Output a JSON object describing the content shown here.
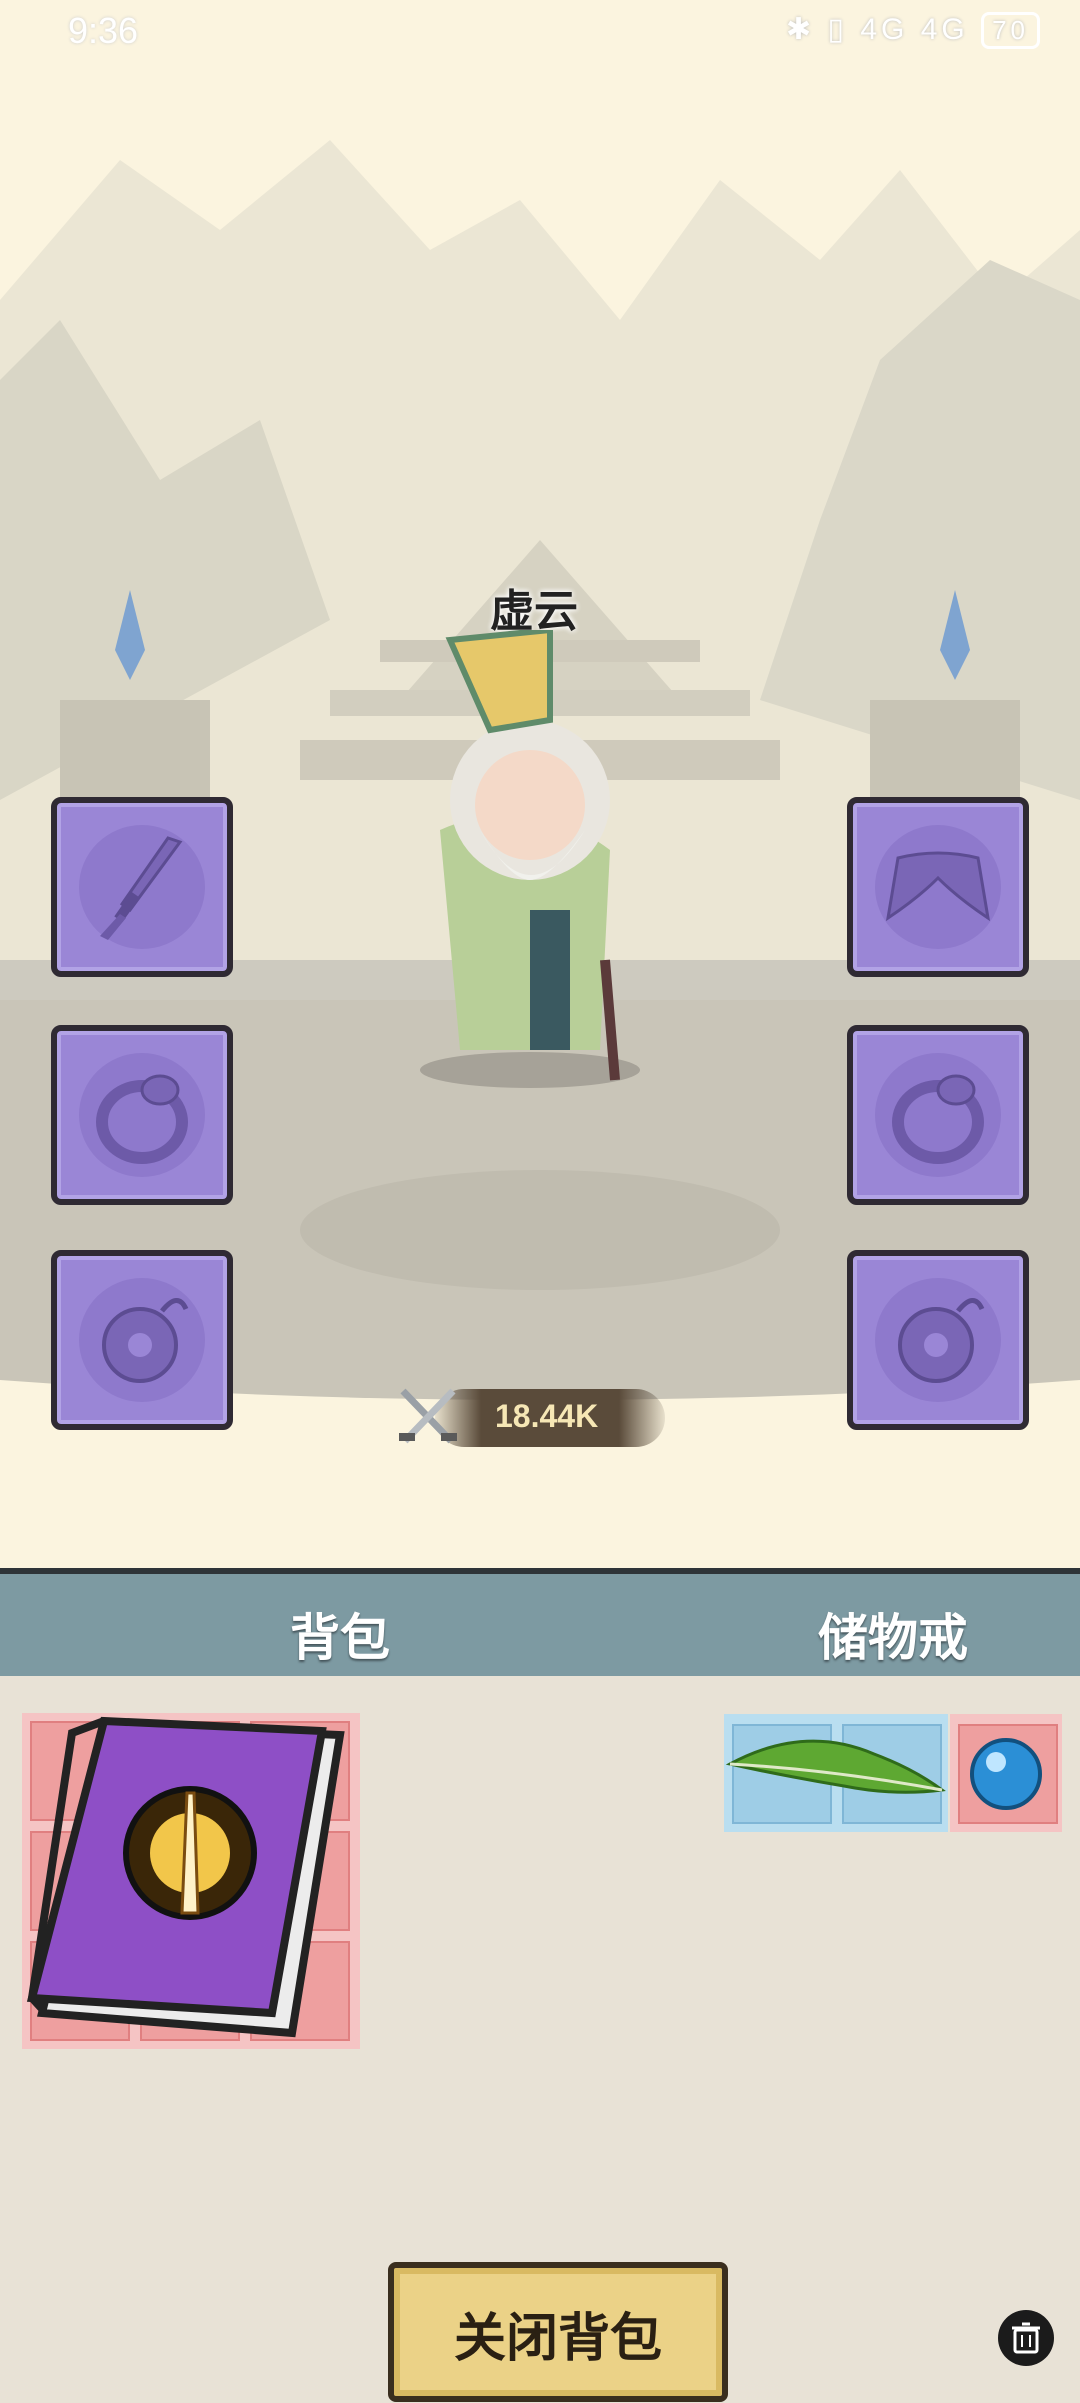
{
  "status": {
    "time": "9:36",
    "right_text": "✱ ▯ 4G 4G",
    "battery": "70"
  },
  "character": {
    "name": "虚云",
    "power": "18.44K"
  },
  "equipment_slots": {
    "left": [
      "sword-icon",
      "ring-icon",
      "pendant-icon"
    ],
    "right": [
      "wings-icon",
      "ring-icon",
      "pendant-icon"
    ]
  },
  "tabs": {
    "backpack": "背包",
    "storage_ring": "储物戒"
  },
  "backpack_items": [
    "skill-book-icon"
  ],
  "storage_items": [
    "feather-icon",
    "blue-orb-icon"
  ],
  "buttons": {
    "close": "关闭背包"
  },
  "colors": {
    "slot": "#9a86d6",
    "tab_bar": "#7d9aa2",
    "grid_pink": "#ee9f9f",
    "grid_blue": "#9ecde6",
    "button": "#ebd287"
  }
}
